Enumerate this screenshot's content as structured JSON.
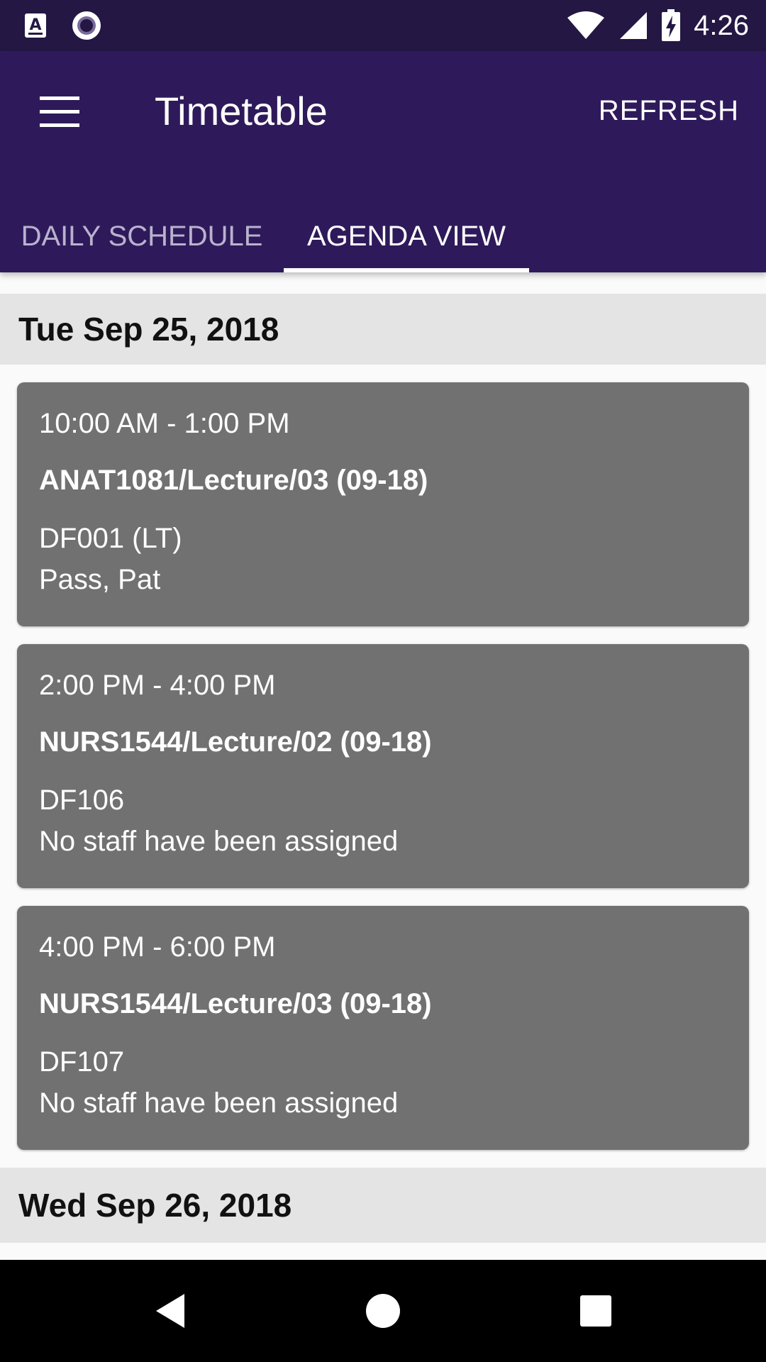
{
  "status_bar": {
    "time": "4:26",
    "left_icons": [
      "accessibility-a-icon",
      "record-circle-icon"
    ],
    "right_icons": [
      "wifi-icon",
      "cell-signal-icon",
      "battery-charging-icon"
    ]
  },
  "app_bar": {
    "title": "Timetable",
    "action_label": "REFRESH",
    "menu_icon": "hamburger-menu-icon"
  },
  "tabs": [
    {
      "label": "DAILY SCHEDULE",
      "selected": false
    },
    {
      "label": "AGENDA VIEW",
      "selected": true
    }
  ],
  "days": [
    {
      "date": "Tue Sep 25, 2018",
      "events": [
        {
          "time": "10:00 AM - 1:00 PM",
          "course": "ANAT1081/Lecture/03 (09-18)",
          "room": "DF001 (LT)",
          "staff": "Pass, Pat"
        },
        {
          "time": "2:00 PM - 4:00 PM",
          "course": "NURS1544/Lecture/02 (09-18)",
          "room": "DF106",
          "staff": "No staff have been assigned"
        },
        {
          "time": "4:00 PM - 6:00 PM",
          "course": "NURS1544/Lecture/03 (09-18)",
          "room": "DF107",
          "staff": "No staff have been assigned"
        }
      ]
    },
    {
      "date": "Wed Sep 26, 2018",
      "events": []
    }
  ],
  "colors": {
    "status_bar": "#241744",
    "app_bar": "#2e1a5a",
    "card": "#717171",
    "date_header": "#e4e4e4"
  },
  "nav_bar": {
    "icons": [
      "back-icon",
      "home-icon",
      "recents-icon"
    ]
  }
}
